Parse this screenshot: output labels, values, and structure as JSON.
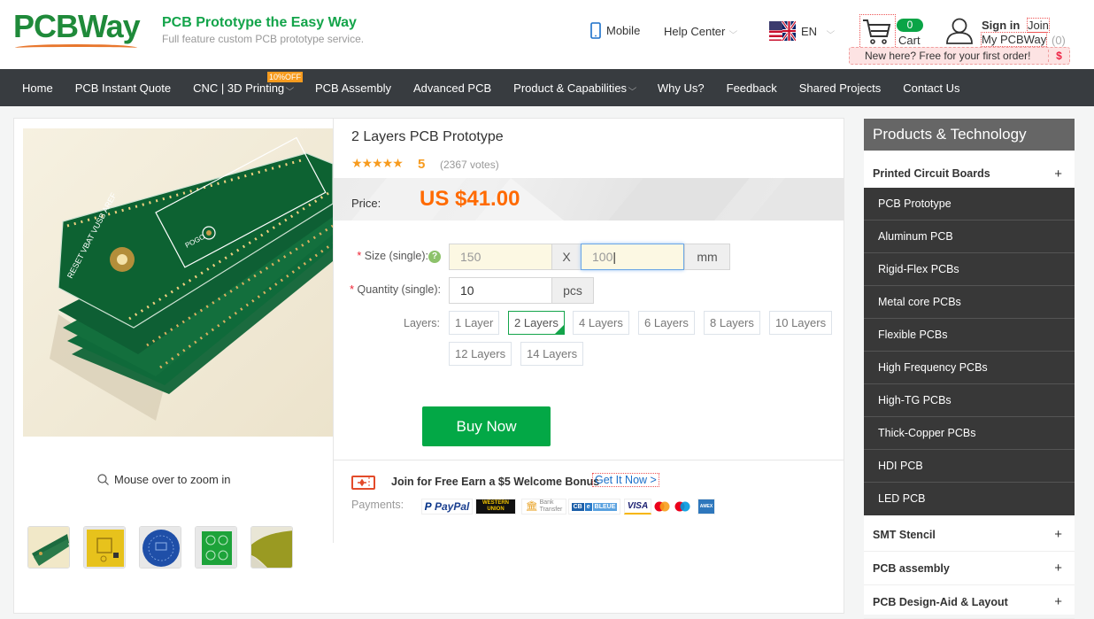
{
  "header": {
    "logo": "PCBWay",
    "slogan_title": "PCB Prototype the Easy Way",
    "slogan_sub": "Full feature custom PCB prototype service.",
    "mobile": "Mobile",
    "help_center": "Help Center",
    "language": "EN",
    "cart_count": "0",
    "cart_label": "Cart",
    "sign_in": "Sign in",
    "join": "Join",
    "my_pcbway": "My PCBWay",
    "my_pcbway_count": "(0)",
    "promo_text": "New here? Free for your first order!",
    "promo_icon": "$"
  },
  "nav": {
    "items": [
      {
        "label": "Home",
        "dropdown": false
      },
      {
        "label": "PCB Instant Quote",
        "dropdown": false
      },
      {
        "label": "CNC | 3D Printing",
        "dropdown": true
      },
      {
        "label": "PCB Assembly",
        "dropdown": false
      },
      {
        "label": "Advanced PCB",
        "dropdown": false
      },
      {
        "label": "Product & Capabilities",
        "dropdown": true
      },
      {
        "label": "Why Us?",
        "dropdown": false
      },
      {
        "label": "Feedback",
        "dropdown": false
      },
      {
        "label": "Shared Projects",
        "dropdown": false
      },
      {
        "label": "Contact Us",
        "dropdown": false
      }
    ],
    "badge": "10%OFF"
  },
  "gallery": {
    "zoom_hint": "Mouse over to zoom in",
    "thumbnails": [
      "pcb-stack",
      "yellow-pcb",
      "blue-round-pcb",
      "green-panel-pcb",
      "flex-pcb"
    ]
  },
  "product": {
    "title": "2 Layers PCB Prototype",
    "stars": "★★★★★",
    "rating": "5",
    "votes": "(2367 votes)",
    "price_label": "Price:",
    "price": "US $41.00",
    "size_label": "Size (single):",
    "size_required": "*",
    "size_width": "150",
    "size_x": "X",
    "size_height": "100",
    "size_unit": "mm",
    "qty_label": "Quantity (single):",
    "qty_value": "10",
    "qty_unit": "pcs",
    "layers_label": "Layers:",
    "layers": [
      "1 Layer",
      "2 Layers",
      "4 Layers",
      "6 Layers",
      "8 Layers",
      "10 Layers",
      "12 Layers",
      "14 Layers"
    ],
    "selected_layer": "2 Layers",
    "buy_now": "Buy Now",
    "bonus_text": "Join for Free Earn a $5 Welcome Bonus",
    "get_it_now": "Get It Now >",
    "payments_label": "Payments:",
    "payments": [
      "PayPal",
      "Western Union",
      "Bank Transfer",
      "CB e-Bleue",
      "VISA",
      "Mastercard",
      "Maestro",
      "American Express"
    ]
  },
  "sidebar": {
    "title": "Products & Technology",
    "categories": [
      {
        "label": "Printed Circuit Boards",
        "icon": "+"
      },
      {
        "label": "SMT Stencil",
        "icon": "+"
      },
      {
        "label": "PCB assembly",
        "icon": "+"
      },
      {
        "label": "PCB Design-Aid & Layout",
        "icon": "+"
      }
    ],
    "pcb_items": [
      "PCB Prototype",
      "Aluminum PCB",
      "Rigid-Flex PCBs",
      "Metal core PCBs",
      "Flexible PCBs",
      "High Frequency PCBs",
      "High-TG PCBs",
      "Thick-Copper PCBs",
      "HDI PCB",
      "LED PCB"
    ]
  },
  "colors": {
    "brand_green": "#13a44a",
    "price_orange": "#ff6a00",
    "nav_bg": "#383c40",
    "buy_green": "#03a846"
  }
}
